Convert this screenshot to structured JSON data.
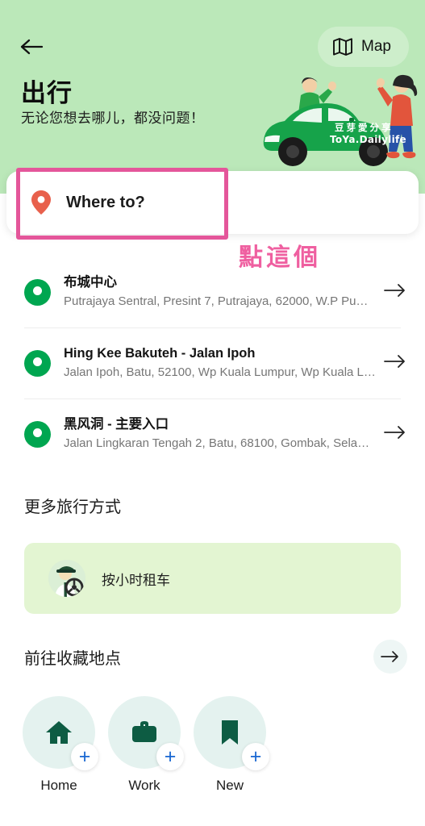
{
  "header": {
    "back_icon": "arrow-left-icon",
    "map_button": {
      "label": "Map",
      "icon": "map-icon"
    },
    "title": "出行",
    "subtitle": "无论您想去哪儿，都没问题！",
    "illustration": {
      "watermark_cn": "豆芽愛分享",
      "watermark_en": "ToYa.Dailylife"
    },
    "bg_color": "#bbe8b9",
    "map_button_color": "#cdeecb"
  },
  "search": {
    "placeholder": "Where to?",
    "pin_icon": "location-pin-icon",
    "pin_color": "#e8604c",
    "highlight_color": "#e4569a"
  },
  "annotation": {
    "text": "點這個",
    "color": "#ef5fa0"
  },
  "suggestions": [
    {
      "title": "布城中心",
      "address": "Putrajaya Sentral, Presint 7, Putrajaya, 62000, W.P Pu…",
      "icon": "location-pin-icon",
      "arrow": "arrow-right-icon"
    },
    {
      "title": "Hing Kee Bakuteh - Jalan Ipoh",
      "address": "Jalan Ipoh, Batu, 52100, Wp Kuala Lumpur, Wp Kuala L…",
      "icon": "location-pin-icon",
      "arrow": "arrow-right-icon"
    },
    {
      "title": "黑风洞 - 主要入口",
      "address": "Jalan Lingkaran Tengah 2, Batu, 68100, Gombak, Sela…",
      "icon": "location-pin-icon",
      "arrow": "arrow-right-icon"
    }
  ],
  "more_travel": {
    "heading": "更多旅行方式",
    "card": {
      "label": "按小时租车",
      "icon": "driver-steering-wheel-icon",
      "bg_color": "#e3f5d2"
    }
  },
  "favorites": {
    "heading": "前往收藏地点",
    "arrow": "arrow-right-icon",
    "items": [
      {
        "label": "Home",
        "icon": "home-icon",
        "badge": "+"
      },
      {
        "label": "Work",
        "icon": "briefcase-icon",
        "badge": "+"
      },
      {
        "label": "New",
        "icon": "bookmark-icon",
        "badge": "+"
      }
    ],
    "icon_color": "#0d5c43",
    "badge_color": "#1967d2"
  },
  "pin_color": "#00a650"
}
